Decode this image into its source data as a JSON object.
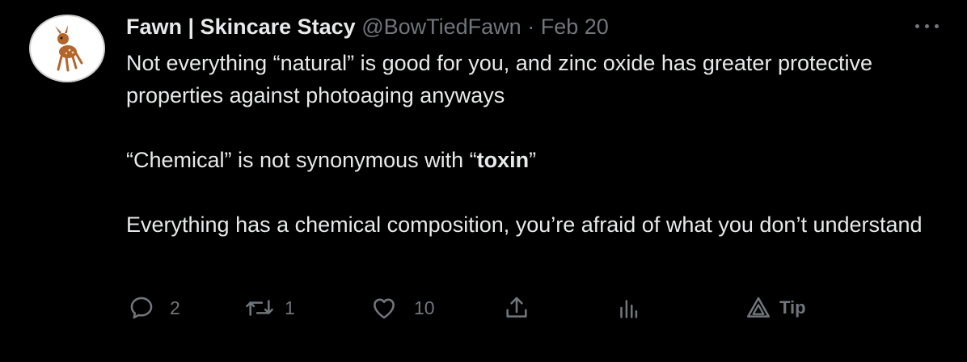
{
  "author": {
    "display_name": "Fawn | Skincare Stacy",
    "handle": "@BowTiedFawn",
    "separator": "·",
    "date": "Feb 20"
  },
  "tweet": {
    "line1": "Not everything “natural” is good for you, and zinc oxide has greater protective properties against photoaging anyways",
    "line2_prefix": "“Chemical” is not synonymous with ",
    "line2_open_quote": "“",
    "line2_bold": "toxin",
    "line2_close_quote": "”",
    "line3": "Everything has a chemical composition, you’re afraid of what you don’t understand"
  },
  "actions": {
    "reply_count": "2",
    "retweet_count": "1",
    "like_count": "10",
    "tip_label": "Tip"
  },
  "icons": {
    "avatar": "bambi-fawn-avatar",
    "more": "more-dots-icon",
    "reply": "reply-icon",
    "retweet": "retweet-icon",
    "like": "heart-icon",
    "share": "share-icon",
    "analytics": "analytics-icon",
    "tip": "tip-icon"
  },
  "colors": {
    "background": "#000000",
    "text": "#e7e9ea",
    "secondary": "#71767b"
  }
}
